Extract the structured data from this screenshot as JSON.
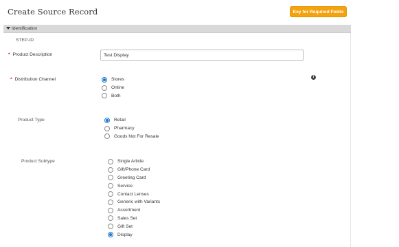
{
  "header": {
    "title": "Create Source Record",
    "key_button": "Key for Required Fields"
  },
  "section": {
    "label": "Identification"
  },
  "fields": {
    "step_id": {
      "label": "STEP-ID"
    },
    "product_description": {
      "label": "Product Description",
      "required_marker": "*",
      "value": "Test Display"
    },
    "distribution_channel": {
      "label": "Distribution Channel",
      "required_marker": "*",
      "info_icon": "info-icon",
      "options": [
        {
          "label": "Stores",
          "checked": true
        },
        {
          "label": "Online",
          "checked": false
        },
        {
          "label": "Both",
          "checked": false
        }
      ]
    },
    "product_type": {
      "label": "Product Type",
      "options": [
        {
          "label": "Retail",
          "checked": true
        },
        {
          "label": "Pharmacy",
          "checked": false
        },
        {
          "label": "Goods Not For Resale",
          "checked": false
        }
      ]
    },
    "product_subtype": {
      "label": "Product Subtype",
      "options": [
        {
          "label": "Single Article",
          "checked": false
        },
        {
          "label": "Gift/Phone Card",
          "checked": false
        },
        {
          "label": "Greeting Card",
          "checked": false
        },
        {
          "label": "Service",
          "checked": false
        },
        {
          "label": "Contact Lenses",
          "checked": false
        },
        {
          "label": "Generic with Variants",
          "checked": false
        },
        {
          "label": "Assortment",
          "checked": false
        },
        {
          "label": "Sales Set",
          "checked": false
        },
        {
          "label": "Gift Set",
          "checked": false
        },
        {
          "label": "Display",
          "checked": true
        }
      ]
    }
  },
  "colors": {
    "accent": "#f2a30f",
    "radio_selected": "#1a73c8",
    "required_star": "#d0021b",
    "section_bar": "#d9d9d9"
  }
}
